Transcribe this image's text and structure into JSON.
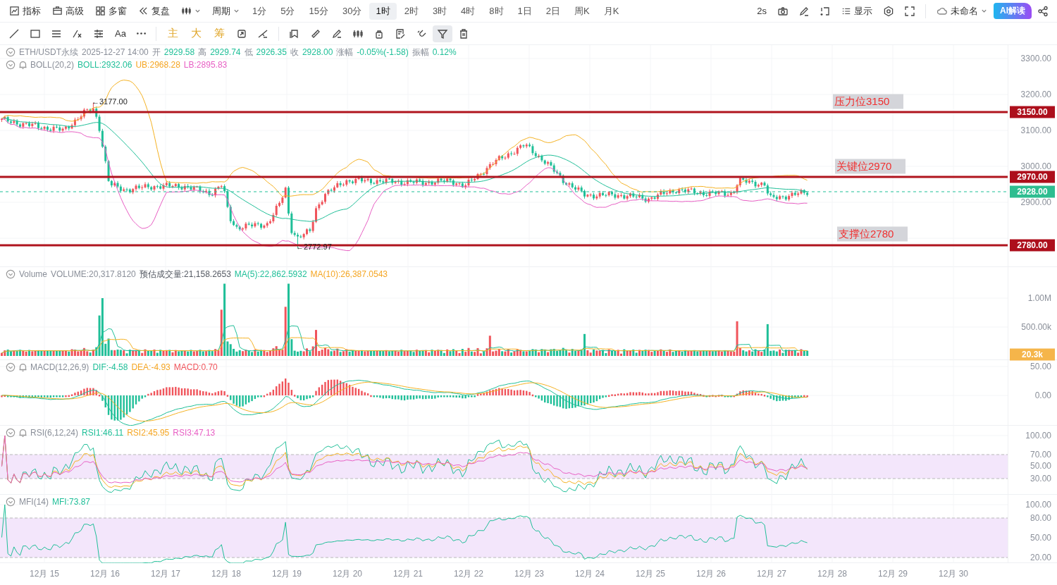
{
  "top_toolbar": {
    "menu": [
      {
        "label": "指标"
      },
      {
        "label": "高级"
      },
      {
        "label": "多窗"
      },
      {
        "label": "复盘"
      }
    ],
    "period_menu": "周期",
    "periods": [
      {
        "label": "1分",
        "selected": false
      },
      {
        "label": "5分",
        "selected": false
      },
      {
        "label": "15分",
        "selected": false
      },
      {
        "label": "30分",
        "selected": false
      },
      {
        "label": "1时",
        "selected": true
      },
      {
        "label": "2时",
        "selected": false
      },
      {
        "label": "3时",
        "selected": false
      },
      {
        "label": "4时",
        "selected": false
      },
      {
        "label": "8时",
        "selected": false
      },
      {
        "label": "1日",
        "selected": false
      },
      {
        "label": "2日",
        "selected": false
      },
      {
        "label": "周K",
        "selected": false
      },
      {
        "label": "月K",
        "selected": false
      }
    ],
    "refresh": "2s",
    "display": "显示",
    "layout_name": "未命名",
    "ai_button": "AI解读"
  },
  "draw_toolbar": {
    "text_tool": "Aa",
    "chip_tools": [
      "主",
      "大",
      "筹"
    ],
    "tools": [
      {
        "selected": false
      },
      {
        "selected": false
      },
      {
        "selected": false
      },
      {
        "selected": false
      },
      {
        "selected": false
      },
      {
        "selected": false
      },
      {
        "selected": false
      },
      {
        "selected": false
      },
      {
        "selected": false
      },
      {
        "selected": true
      },
      {
        "selected": false
      }
    ]
  },
  "main_pane": {
    "symbol": "ETH/USDT永续",
    "time": "2025-12-27 14:00",
    "quote": [
      {
        "label": "开",
        "value": "2929.58"
      },
      {
        "label": "高",
        "value": "2929.74"
      },
      {
        "label": "低",
        "value": "2926.35"
      },
      {
        "label": "收",
        "value": "2928.00"
      },
      {
        "label": "涨幅",
        "value": "-0.05%(-1.58)"
      },
      {
        "label": "振幅",
        "value": "0.12%"
      }
    ],
    "indicator": {
      "name": "BOLL(20,2)",
      "alert": true,
      "values": [
        {
          "text": "BOLL:2932.06",
          "color": "#1fbf98"
        },
        {
          "text": "UB:2968.28",
          "color": "#f5a623"
        },
        {
          "text": "LB:2895.83",
          "color": "#e85fc4"
        }
      ]
    },
    "high_marker": "←3177.00",
    "low_marker": "←2772.97",
    "levels": [
      {
        "label": "压力位3150",
        "tag": "3150.00"
      },
      {
        "label": "关键位2970",
        "tag": "2970.00"
      },
      {
        "label": "支撑位2780",
        "tag": "2780.00"
      }
    ],
    "last_price": "2928.00",
    "axis": [
      "3300.00",
      "3200.00",
      "3100.00",
      "3000.00",
      "2900.00"
    ]
  },
  "volume_pane": {
    "name": "Volume",
    "alert": false,
    "values": [
      {
        "text": "VOLUME:20,317.8120",
        "color": "#8a8f99"
      },
      {
        "text": "预估成交量:21,158.2653",
        "color": "#555a63"
      },
      {
        "text": "MA(5):22,862.5932",
        "color": "#1fbf98"
      },
      {
        "text": "MA(10):26,387.0543",
        "color": "#f5a623"
      }
    ],
    "axis": [
      "1.00M",
      "500.00k"
    ],
    "last_volume": "20.3k"
  },
  "macd_pane": {
    "name": "MACD(12,26,9)",
    "alert": true,
    "values": [
      {
        "text": "DIF:-4.58",
        "color": "#1fbf98"
      },
      {
        "text": "DEA:-4.93",
        "color": "#f5a623"
      },
      {
        "text": "MACD:0.70",
        "color": "#f0545b"
      }
    ],
    "axis": [
      "50.00",
      "0.00"
    ]
  },
  "rsi_pane": {
    "name": "RSI(6,12,24)",
    "alert": true,
    "values": [
      {
        "text": "RSI1:46.11",
        "color": "#1fbf98"
      },
      {
        "text": "RSI2:45.95",
        "color": "#f5a623"
      },
      {
        "text": "RSI3:47.13",
        "color": "#e85fc4"
      }
    ],
    "axis": [
      "100.00",
      "70.00",
      "50.00",
      "30.00"
    ]
  },
  "mfi_pane": {
    "name": "MFI(14)",
    "alert": false,
    "values": [
      {
        "text": "MFI:73.87",
        "color": "#1fbf98"
      }
    ],
    "axis": [
      "100.00",
      "80.00",
      "50.00",
      "20.00"
    ]
  },
  "x_axis": [
    "12月 15",
    "12月 16",
    "12月 17",
    "12月 18",
    "12月 19",
    "12月 20",
    "12月 21",
    "12月 22",
    "12月 23",
    "12月 24",
    "12月 25",
    "12月 26",
    "12月 27",
    "12月 28",
    "12月 29",
    "12月 30"
  ]
}
